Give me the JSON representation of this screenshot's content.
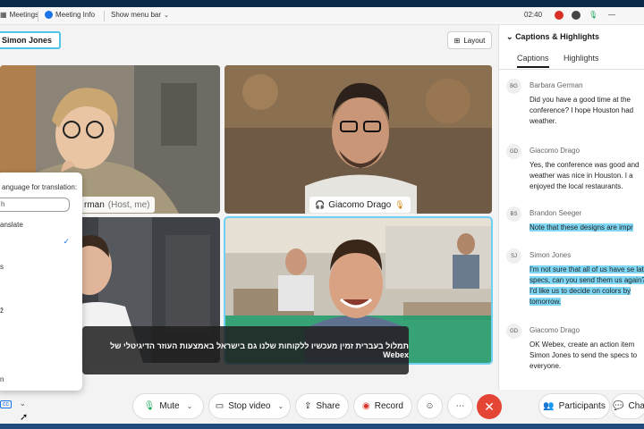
{
  "topbar": {
    "meetings": "Meetings",
    "meeting_info": "Meeting Info",
    "show_menu_bar": "Show menu bar",
    "time": "02:40"
  },
  "name_chip": "Simon Jones",
  "layout_label": "Layout",
  "tiles": [
    {
      "name": "rman",
      "suffix": "(Host, me)"
    },
    {
      "name": "Giacomo Drago"
    }
  ],
  "lang_menu": {
    "header": "anguage for translation:",
    "search_placeholder": "h",
    "options": [
      "anslate",
      "s",
      "ž",
      "n"
    ]
  },
  "caption_overlay": "תמלול בעברית זמין מעכשיו ללקוחות שלנו גם בישראל באמצעות העוזר הדיגיטלי של Webex",
  "toolbar": {
    "mute": "Mute",
    "stop_video": "Stop video",
    "share": "Share",
    "record": "Record",
    "participants": "Participants",
    "chat": "Cha"
  },
  "panel": {
    "title": "Captions & Highlights",
    "tabs": [
      "Captions",
      "Highlights"
    ],
    "entries": [
      {
        "initials": "BG",
        "speaker": "Barbara German",
        "text": "Did you have a good time at the conference? I hope Houston had weather.",
        "highlight": false
      },
      {
        "initials": "GD",
        "speaker": "Giacomo Drago",
        "text": "Yes, the conference was good and weather was nice in Houston. I a enjoyed the local restaurants.",
        "highlight": false
      },
      {
        "initials": "BS",
        "speaker": "Brandon Seeger",
        "text": "Note that these designs are impr",
        "highlight": true
      },
      {
        "initials": "SJ",
        "speaker": "Simon Jones",
        "text": "I'm not sure that all of us have se latest specs, can you send them us again? I'd like us to decide on colors by tomorrow.",
        "highlight": true
      },
      {
        "initials": "GD",
        "speaker": "Giacomo Drago",
        "text": "OK Webex, create an action item Simon Jones to send the specs to everyone.",
        "highlight": false
      }
    ]
  },
  "colors": {
    "accent": "#4fc3e8",
    "highlight": "#7fd7f5",
    "end_call": "#e54535"
  }
}
